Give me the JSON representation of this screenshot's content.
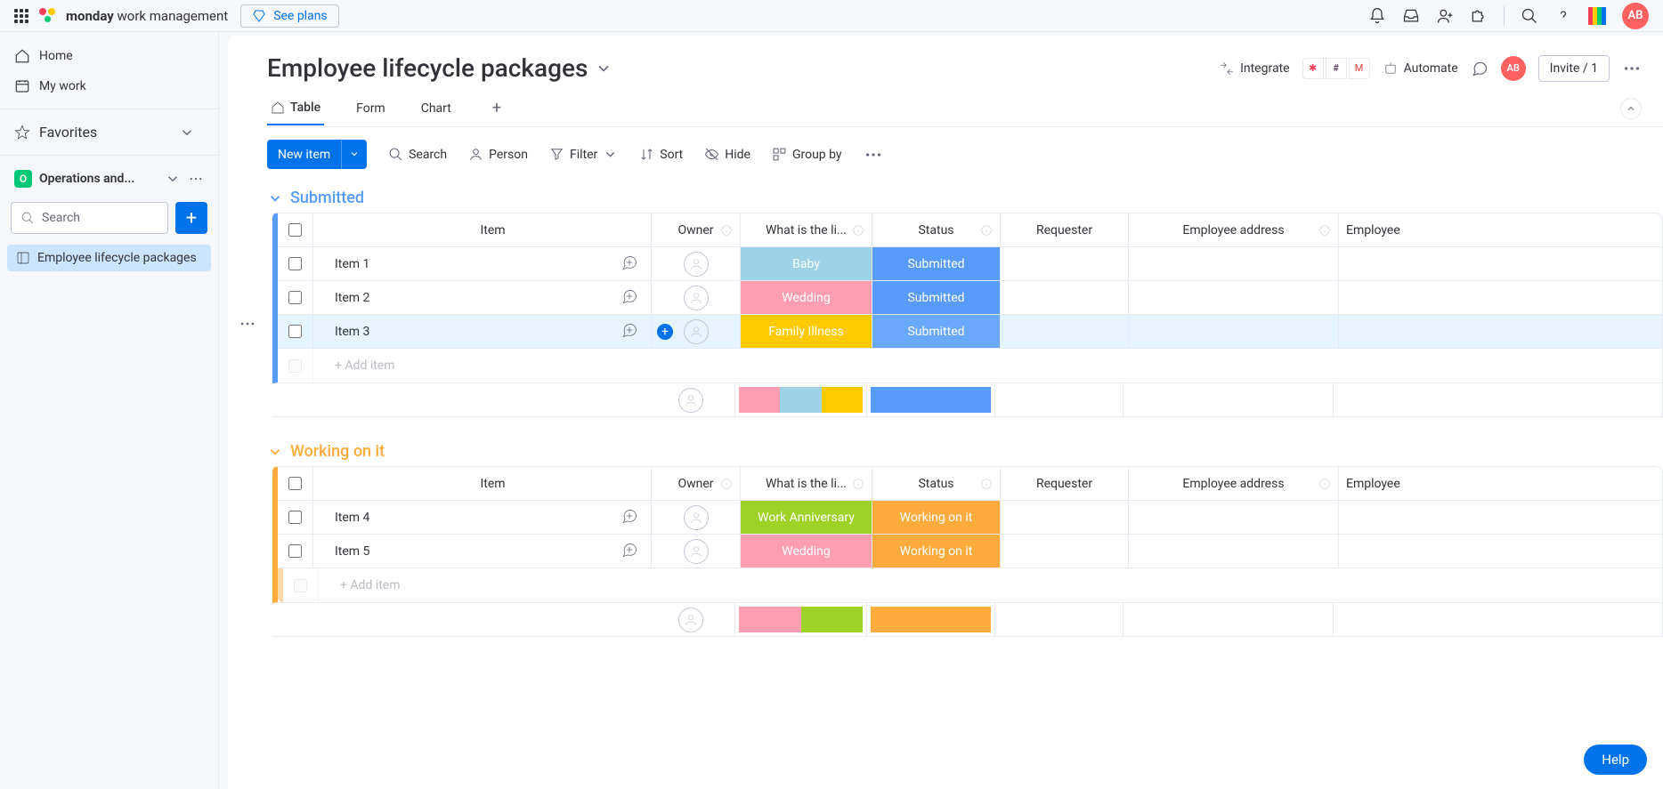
{
  "topbar": {
    "brand_bold": "monday",
    "brand_rest": " work management",
    "see_plans": "See plans",
    "avatar": "AB"
  },
  "sidebar": {
    "home": "Home",
    "mywork": "My work",
    "favorites": "Favorites",
    "workspace_letter": "O",
    "workspace_name": "Operations and...",
    "search_placeholder": "Search",
    "board_name": "Employee lifecycle packages"
  },
  "board": {
    "title": "Employee lifecycle packages",
    "integrate": "Integrate",
    "automate": "Automate",
    "invite": "Invite / 1",
    "avatar": "AB"
  },
  "views": {
    "table": "Table",
    "form": "Form",
    "chart": "Chart"
  },
  "toolbar": {
    "new_item": "New item",
    "search": "Search",
    "person": "Person",
    "filter": "Filter",
    "sort": "Sort",
    "hide": "Hide",
    "groupby": "Group by"
  },
  "columns": {
    "item": "Item",
    "owner": "Owner",
    "event": "What is the li...",
    "status": "Status",
    "requester": "Requester",
    "address": "Employee address",
    "employee": "Employee"
  },
  "groups": [
    {
      "name": "Submitted",
      "color_class": "group-blue",
      "items": [
        {
          "name": "Item 1",
          "event": "Baby",
          "event_color": "#9ed2e6",
          "status": "Submitted",
          "status_color": "#579bfc",
          "hover": false
        },
        {
          "name": "Item 2",
          "event": "Wedding",
          "event_color": "#ff9eb0",
          "status": "Submitted",
          "status_color": "#579bfc",
          "hover": false
        },
        {
          "name": "Item 3",
          "event": "Family Illness",
          "event_color": "#ffcb00",
          "status": "Submitted",
          "status_color": "#6aa8fc",
          "hover": true
        }
      ],
      "summary_event_colors": [
        "#ff9eb0",
        "#9ed2e6",
        "#ffcb00"
      ],
      "summary_status_colors": [
        "#579bfc"
      ]
    },
    {
      "name": "Working on it",
      "color_class": "group-orange",
      "items": [
        {
          "name": "Item 4",
          "event": "Work Anniversary",
          "event_color": "#9cd326",
          "status": "Working on it",
          "status_color": "#fdab3d",
          "hover": false
        },
        {
          "name": "Item 5",
          "event": "Wedding",
          "event_color": "#ff9eb0",
          "status": "Working on it",
          "status_color": "#fdab3d",
          "hover": false
        }
      ],
      "summary_event_colors": [
        "#ff9eb0",
        "#9cd326"
      ],
      "summary_status_colors": [
        "#fdab3d"
      ]
    }
  ],
  "add_item": "+ Add item",
  "help": "Help"
}
